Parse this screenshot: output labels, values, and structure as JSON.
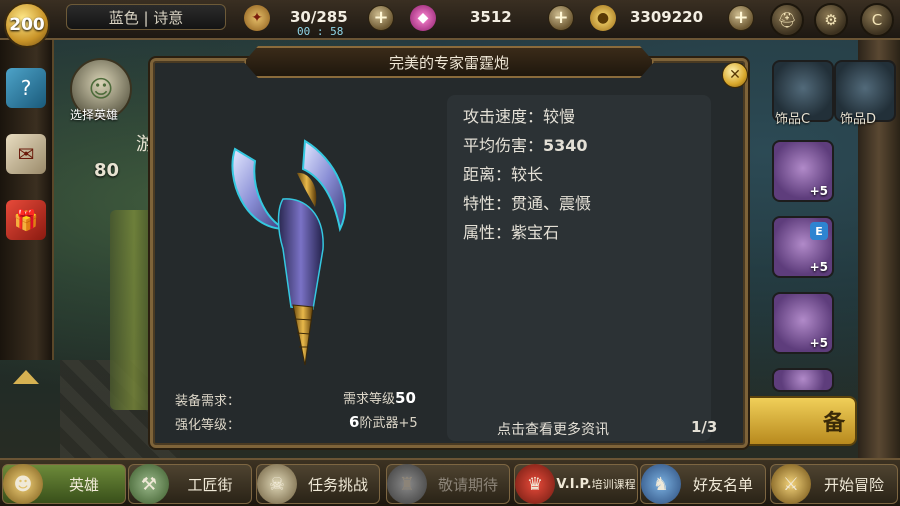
{
  "topbar": {
    "level": "200",
    "player_name": "蓝色 | 诗意",
    "stamina": "30/285",
    "timer": "00 : 58",
    "gems": "3512",
    "gold": "3309220",
    "plus_symbol": "+",
    "icons": {
      "stamina_icon": "leaf-badge-icon",
      "gem_icon": "pink-gem-icon",
      "gold_icon": "gold-coin-icon",
      "menu1_icon": "helmet-icon",
      "settings_icon": "gear-icon",
      "menu3_icon": "shield-c-icon"
    }
  },
  "sidebar": {
    "hero_select_label": "选择英雄",
    "hero_level": "80",
    "partial_text": "游"
  },
  "accessories": {
    "label_c": "饰品C",
    "label_d": "饰品D",
    "plus_values": [
      "+5",
      "+5",
      "+5"
    ],
    "badge_letter": "E",
    "banner_partial": "备"
  },
  "modal": {
    "title": "完美的专家雷霆炮",
    "close_symbol": "✕",
    "stats": {
      "attack_speed_label": "攻击速度：",
      "attack_speed_value": "较慢",
      "avg_damage_label": "平均伤害：",
      "avg_damage_value": "5340",
      "distance_label": "距离：",
      "distance_value": "较长",
      "trait_label": "特性：",
      "trait_value": "贯通、震慑",
      "attribute_label": "属性：",
      "attribute_value": "紫宝石"
    },
    "requirements": {
      "equip_req_label": "装备需求：",
      "equip_req_value_prefix": "需求等级",
      "equip_req_value_num": "50",
      "enhance_label": "强化等级：",
      "enhance_value_num": "6",
      "enhance_value_suffix": "阶武器+5"
    },
    "more_info": "点击查看更多资讯",
    "page": "1/3"
  },
  "bottom_nav": {
    "items": [
      {
        "label": "英雄",
        "icon": "hero-face-icon"
      },
      {
        "label": "工匠街",
        "icon": "craftsman-icon"
      },
      {
        "label": "任务挑战",
        "icon": "quest-icon"
      },
      {
        "label": "敬请期待",
        "icon": "castle-icon"
      },
      {
        "label_bold": "V.I.P.",
        "label_small": "培训课程",
        "icon": "vip-crest-icon"
      },
      {
        "label": "好友名单",
        "icon": "wizard-friend-icon"
      },
      {
        "label": "开始冒险",
        "icon": "adventure-icon"
      }
    ]
  },
  "colors": {
    "frame_gold": "#7e6339",
    "modal_bg": "#252a2c",
    "stats_bg": "#2c3235",
    "active_nav": "#6d8a3a"
  }
}
